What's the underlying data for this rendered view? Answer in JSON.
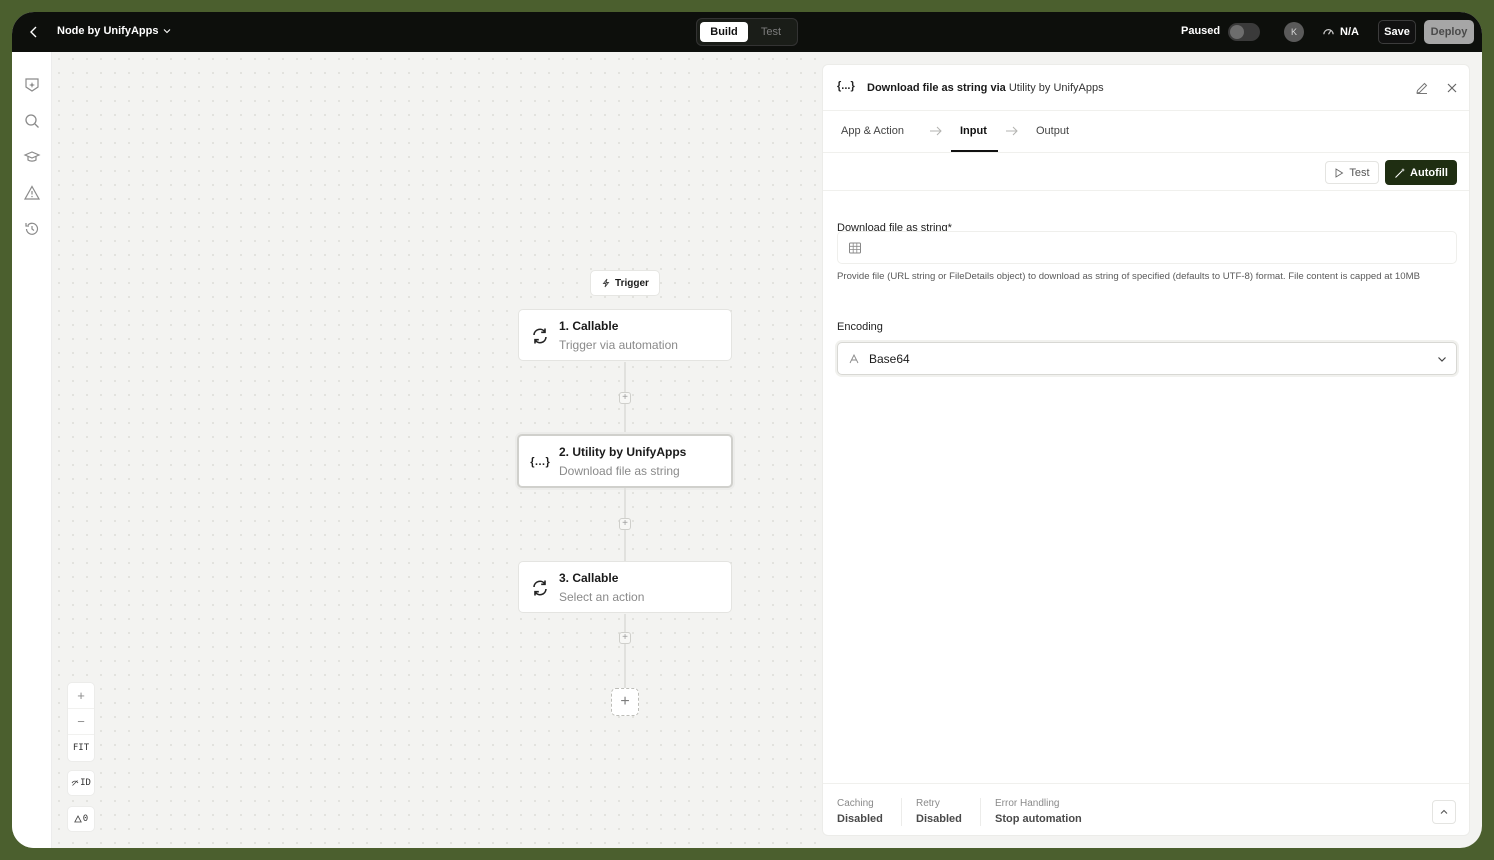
{
  "header": {
    "app_name": "Node by UnifyApps",
    "modes": [
      "Build",
      "Test"
    ],
    "paused_label": "Paused",
    "avatar_initial": "K",
    "status_value": "N/A",
    "save_label": "Save",
    "deploy_label": "Deploy"
  },
  "canvas": {
    "trigger_label": "Trigger",
    "nodes": [
      {
        "title": "1. Callable",
        "subtitle": "Trigger via automation",
        "icon": "refresh-icon"
      },
      {
        "title": "2. Utility by UnifyApps",
        "subtitle": "Download file as string",
        "icon": "braces-icon"
      },
      {
        "title": "3. Callable",
        "subtitle": "Select an action",
        "icon": "refresh-icon"
      }
    ],
    "zoom": {
      "in": "+",
      "out": "−",
      "fit": "FIT"
    },
    "id_chip": "ID",
    "warn_chip": "0"
  },
  "panel": {
    "brace": "{...}",
    "title_action": "Download file as string via",
    "title_app": "Utility by UnifyApps",
    "tabs": [
      "App & Action",
      "Input",
      "Output"
    ],
    "active_tab": "Input",
    "test_label": "Test",
    "autofill_label": "Autofill",
    "field1_label": "Download file as string*",
    "field1_value": "",
    "field1_help": "Provide file (URL string or FileDetails object) to download as string of specified (defaults to UTF-8) format. File content is capped at 10MB",
    "field2_label": "Encoding",
    "field2_value": "Base64",
    "footer": [
      {
        "label": "Caching",
        "value": "Disabled"
      },
      {
        "label": "Retry",
        "value": "Disabled"
      },
      {
        "label": "Error Handling",
        "value": "Stop automation"
      }
    ]
  },
  "colors": {
    "frame_bg": "#4b5f2e",
    "topbar_bg": "#0d0f0c",
    "autofill_bg": "#1f2e12"
  }
}
